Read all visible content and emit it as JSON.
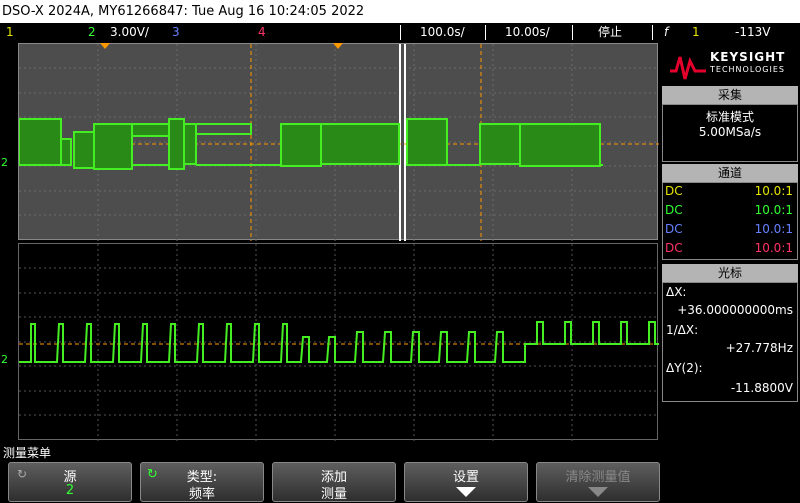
{
  "title": "DSO-X 2024A, MY61266847: Tue Aug 16 10:24:05 2022",
  "status": {
    "ch1_num": "1",
    "ch2_num": "2",
    "ch2_scale": "3.00V/",
    "ch3_num": "3",
    "ch4_num": "4",
    "timebase": "100.0s/",
    "zoom_timebase": "10.00s/",
    "run_state": "停止",
    "trigger_icon": "f",
    "trigger_source": "1",
    "trigger_level": "-113V"
  },
  "logo": {
    "line1": "KEYSIGHT",
    "line2": "TECHNOLOGIES"
  },
  "acquire": {
    "header": "采集",
    "mode": "标准模式",
    "rate": "5.00MSa/s"
  },
  "channels": {
    "header": "通道",
    "rows": [
      {
        "coupling": "DC",
        "probe": "10.0:1",
        "color": "#e5e500"
      },
      {
        "coupling": "DC",
        "probe": "10.0:1",
        "color": "#33ff33"
      },
      {
        "coupling": "DC",
        "probe": "10.0:1",
        "color": "#6680ff"
      },
      {
        "coupling": "DC",
        "probe": "10.0:1",
        "color": "#ff3366"
      }
    ]
  },
  "cursors": {
    "header": "光标",
    "dx_label": "ΔX:",
    "dx_value": "+36.000000000ms",
    "inv_label": "1/ΔX:",
    "inv_value": "+27.778Hz",
    "dy_label": "ΔY(2):",
    "dy_value": "-11.8800V"
  },
  "menu_title": "测量菜单",
  "softkeys": [
    {
      "line1": "源",
      "line2": "2"
    },
    {
      "line1": "类型:",
      "line2": "频率"
    },
    {
      "line1": "添加",
      "line2": "测量"
    },
    {
      "line1": "设置",
      "line2": ""
    },
    {
      "line1": "清除测量值",
      "line2": ""
    }
  ],
  "markers": {
    "ch_ref_top": "2",
    "ch_ref_bottom": "2"
  },
  "colors": {
    "trace": "#33ff33",
    "cursor": "#ff9900",
    "grid": "#888888"
  }
}
